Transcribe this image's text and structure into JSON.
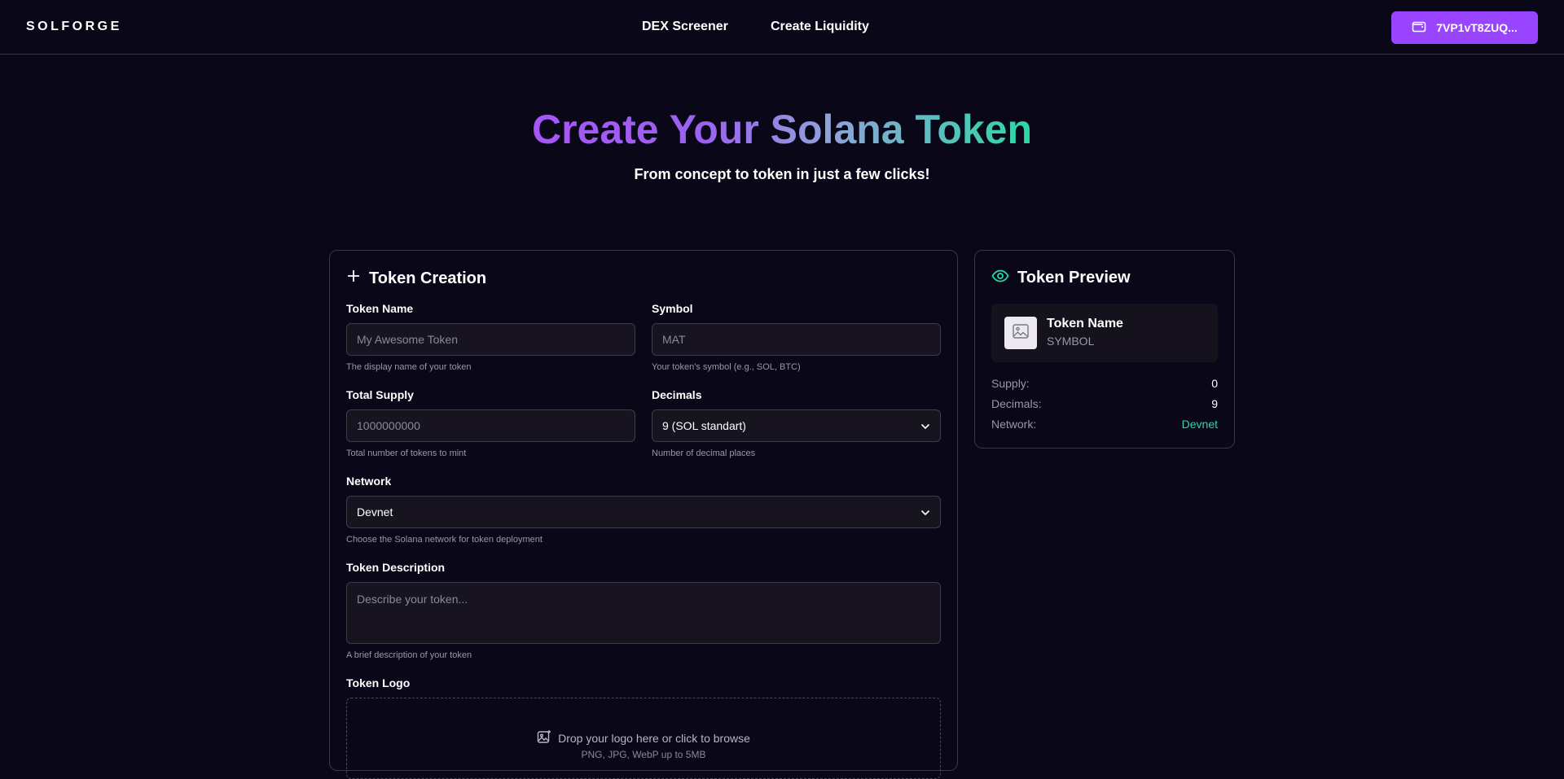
{
  "header": {
    "logo": "SOLFORGE",
    "nav": [
      "DEX Screener",
      "Create Liquidity"
    ],
    "wallet_label": "7VP1vT8ZUQ..."
  },
  "hero": {
    "title": "Create Your Solana Token",
    "subtitle": "From concept to token in just a few clicks!"
  },
  "form": {
    "title": "Token Creation",
    "token_name": {
      "label": "Token Name",
      "placeholder": "My Awesome Token",
      "value": "",
      "hint": "The display name of your token"
    },
    "symbol": {
      "label": "Symbol",
      "placeholder": "MAT",
      "value": "",
      "hint": "Your token's symbol (e.g., SOL, BTC)"
    },
    "total_supply": {
      "label": "Total Supply",
      "placeholder": "1000000000",
      "value": "",
      "hint": "Total number of tokens to mint"
    },
    "decimals": {
      "label": "Decimals",
      "selected": "9 (SOL standart)",
      "hint": "Number of decimal places"
    },
    "network": {
      "label": "Network",
      "selected": "Devnet",
      "hint": "Choose the Solana network for token deployment"
    },
    "description": {
      "label": "Token Description",
      "placeholder": "Describe your token...",
      "value": "",
      "hint": "A brief description of your token"
    },
    "logo": {
      "label": "Token Logo",
      "dropzone_text": "Drop your logo here or click to browse",
      "dropzone_subtext": "PNG, JPG, WebP up to 5MB"
    }
  },
  "preview": {
    "title": "Token Preview",
    "token_name": "Token Name",
    "symbol": "SYMBOL",
    "stats": [
      {
        "key": "Supply:",
        "value": "0"
      },
      {
        "key": "Decimals:",
        "value": "9"
      },
      {
        "key": "Network:",
        "value": "Devnet"
      }
    ]
  },
  "colors": {
    "background": "#0a0718",
    "accent": "#9945ff",
    "green": "#2bd9a5"
  }
}
